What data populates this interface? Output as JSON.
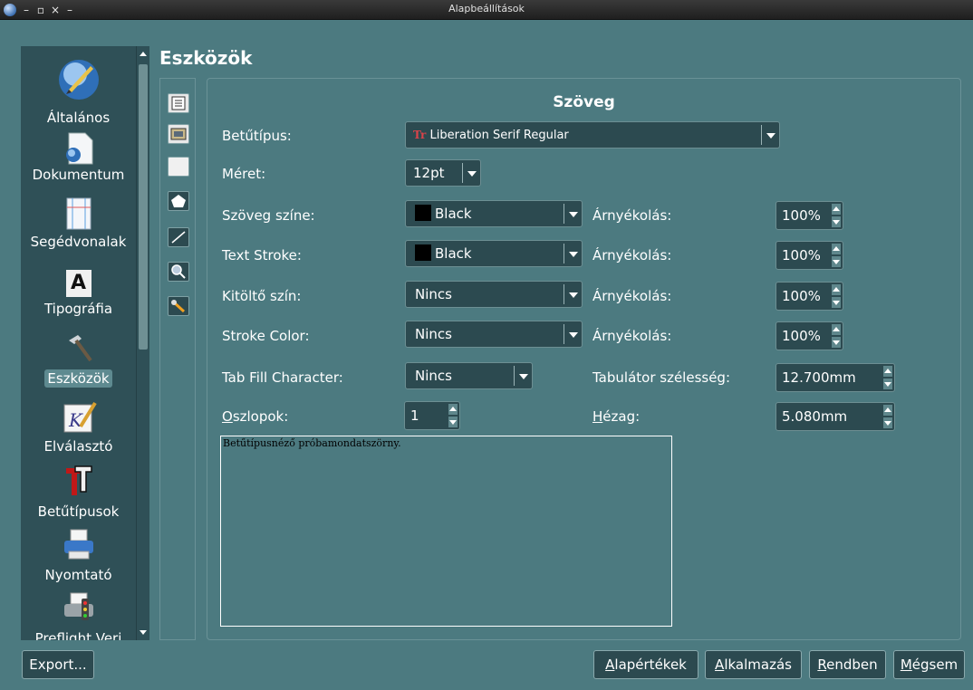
{
  "window": {
    "title": "Alapbeállítások",
    "controls": [
      "–",
      "▫",
      "×",
      "–"
    ]
  },
  "sidebar": {
    "items": [
      {
        "label": "Általános",
        "icon": "general-icon"
      },
      {
        "label": "Dokumentum",
        "icon": "document-icon"
      },
      {
        "label": "Segédvonalak",
        "icon": "guides-icon"
      },
      {
        "label": "Tipográfia",
        "icon": "typography-icon",
        "glyph": "A"
      },
      {
        "label": "Eszközök",
        "icon": "tools-icon",
        "active": true
      },
      {
        "label": "Elválasztó",
        "icon": "hyphenator-icon"
      },
      {
        "label": "Betűtípusok",
        "icon": "fonts-icon"
      },
      {
        "label": "Nyomtató",
        "icon": "printer-icon"
      },
      {
        "label": "Preflight Veri",
        "icon": "preflight-icon"
      }
    ]
  },
  "page_title": "Eszközök",
  "tool_tabs": [
    "text-frame-icon",
    "image-frame-icon",
    "shape-icon",
    "polygon-icon",
    "line-icon",
    "zoom-icon",
    "misc-tool-icon"
  ],
  "section_title": "Szöveg",
  "form": {
    "font": {
      "label": "Betűtípus:",
      "value": "Liberation Serif Regular",
      "glyph": "Tr"
    },
    "size": {
      "label": "Méret:",
      "value": "12pt"
    },
    "text_color": {
      "label": "Szöveg színe:",
      "value": "Black",
      "shade_label": "Árnyékolás:",
      "shade": "100%"
    },
    "text_stroke": {
      "label": "Text Stroke:",
      "value": "Black",
      "shade_label": "Árnyékolás:",
      "shade": "100%"
    },
    "fill_color": {
      "label": "Kitöltő szín:",
      "value": "Nincs",
      "shade_label": "Árnyékolás:",
      "shade": "100%"
    },
    "stroke_color": {
      "label": "Stroke Color:",
      "value": "Nincs",
      "shade_label": "Árnyékolás:",
      "shade": "100%"
    },
    "tab_fill": {
      "label": "Tab Fill Character:",
      "value": "Nincs",
      "width_label": "Tabulátor szélesség:",
      "width": "12.700mm"
    },
    "columns": {
      "label_accel": "O",
      "label_rest": "szlopok:",
      "value": "1",
      "gap_label_accel": "H",
      "gap_label_rest": "ézag:",
      "gap": "5.080mm"
    }
  },
  "preview_text": "Betűtípusnéző próbamondatszörny.",
  "buttons": {
    "export": "Export...",
    "defaults_accel": "A",
    "defaults_rest": "lapértékek",
    "apply_accel": "A",
    "apply_rest": "lkalmazás",
    "ok_accel": "R",
    "ok_rest": "endben",
    "cancel_accel": "M",
    "cancel_rest": "égsem"
  }
}
